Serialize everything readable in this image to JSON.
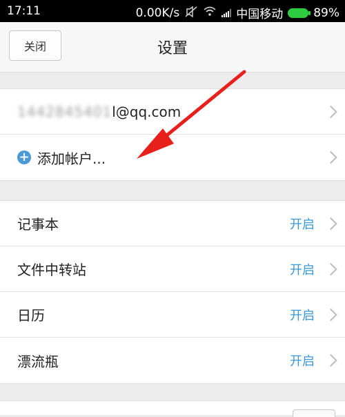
{
  "status_bar": {
    "time": "17:11",
    "speed": "0.00K/s",
    "carrier": "中国移动",
    "battery": "89%",
    "battery_color": "#2ecc40"
  },
  "header": {
    "close_label": "关闭",
    "title": "设置"
  },
  "accounts": {
    "email_blurred": "1442845401",
    "email_suffix": "l@qq.com",
    "add_account_label": "添加帐户..."
  },
  "features": [
    {
      "label": "记事本",
      "status": "开启"
    },
    {
      "label": "文件中转站",
      "status": "开启"
    },
    {
      "label": "日历",
      "status": "开启"
    },
    {
      "label": "漂流瓶",
      "status": "开启"
    }
  ],
  "icons": {
    "mute": "mute-icon",
    "wifi": "wifi-icon",
    "signal": "signal-icon",
    "battery": "battery-icon",
    "add": "plus-circle-icon",
    "chevron": "chevron-right-icon",
    "annotation": "red-arrow-icon"
  },
  "colors": {
    "accent": "#3a97d6",
    "plus": "#4a9ad8",
    "annotation_arrow": "#e8201b"
  }
}
